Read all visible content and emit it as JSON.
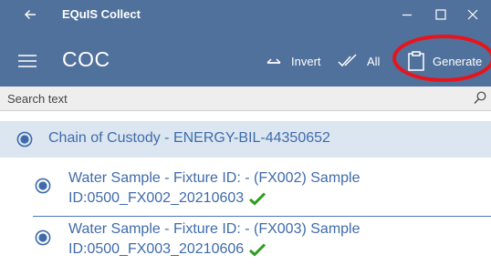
{
  "titlebar": {
    "app_title": "EQuIS Collect",
    "icons": {
      "back": "back-arrow-icon",
      "minimize": "minimize-icon",
      "maximize": "maximize-icon",
      "close": "close-icon"
    }
  },
  "appbar": {
    "title": "COC",
    "actions": {
      "invert_label": "Invert",
      "all_label": "All",
      "generate_label": "Generate"
    },
    "icons": {
      "menu": "hamburger-menu-icon",
      "invert": "swap-arrows-icon",
      "all": "double-check-icon",
      "generate": "clipboard-icon"
    }
  },
  "search": {
    "placeholder": "Search text",
    "value": "",
    "icon": "search-icon"
  },
  "coc": {
    "label": "Chain of Custody - ENERGY-BIL-44350652"
  },
  "samples": [
    {
      "line1": "Water Sample - Fixture ID:  - (FX002)    Sample",
      "line2": "ID:0500_FX002_20210603"
    },
    {
      "line1": "Water Sample - Fixture ID:  - (FX003)    Sample",
      "line2": "ID:0500_FX003_20210606"
    }
  ],
  "colors": {
    "header_bg": "#50719b",
    "text_blue": "#3f6bab",
    "check_green": "#2e9e1e",
    "highlight_red": "#e8141c"
  }
}
